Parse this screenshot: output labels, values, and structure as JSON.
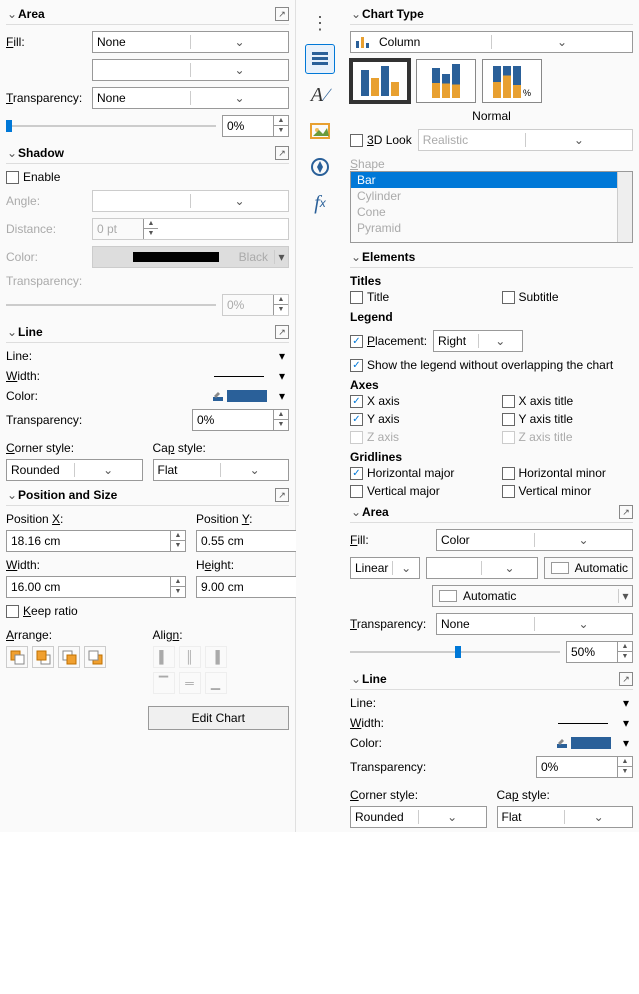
{
  "left": {
    "area": {
      "title": "Area",
      "fill_label": "Fill:",
      "fill_value": "None",
      "secondary": "",
      "trans_label": "Transparency:",
      "trans_value": "None",
      "trans_pct": "0%"
    },
    "shadow": {
      "title": "Shadow",
      "enable": "Enable",
      "angle": "Angle:",
      "distance": "Distance:",
      "distance_val": "0 pt",
      "color": "Color:",
      "color_val": "Black",
      "trans": "Transparency:",
      "trans_val": "0%"
    },
    "line": {
      "title": "Line",
      "line_label": "Line:",
      "width_label": "Width:",
      "color_label": "Color:",
      "trans_label": "Transparency:",
      "trans_val": "0%",
      "corner": "Corner style:",
      "corner_val": "Rounded",
      "cap": "Cap style:",
      "cap_val": "Flat"
    },
    "pos": {
      "title": "Position and Size",
      "px": "Position X:",
      "px_val": "18.16 cm",
      "py": "Position Y:",
      "py_val": "0.55 cm",
      "w": "Width:",
      "w_val": "16.00 cm",
      "h": "Height:",
      "h_val": "9.00 cm",
      "keep": "Keep ratio",
      "arrange": "Arrange:",
      "align": "Align:",
      "edit": "Edit Chart"
    }
  },
  "right": {
    "ct": {
      "title": "Chart Type",
      "type": "Column",
      "subtype_label": "Normal",
      "look3d": "3D Look",
      "look3d_val": "Realistic",
      "shape_label": "Shape",
      "shapes": [
        "Bar",
        "Cylinder",
        "Cone",
        "Pyramid"
      ]
    },
    "el": {
      "title": "Elements",
      "titles": "Titles",
      "title_cb": "Title",
      "subtitle_cb": "Subtitle",
      "legend": "Legend",
      "placement": "Placement:",
      "placement_val": "Right",
      "show_legend": "Show the legend without overlapping the chart",
      "axes": "Axes",
      "xaxis": "X axis",
      "yaxis": "Y axis",
      "zaxis": "Z axis",
      "xtitle": "X axis title",
      "ytitle": "Y axis title",
      "ztitle": "Z axis title",
      "grid": "Gridlines",
      "hm": "Horizontal major",
      "hmn": "Horizontal minor",
      "vm": "Vertical major",
      "vmn": "Vertical minor"
    },
    "area": {
      "title": "Area",
      "fill": "Fill:",
      "fill_val": "Color",
      "linear": "Linear",
      "auto": "Automatic",
      "auto2": "Automatic",
      "trans": "Transparency:",
      "trans_val": "None",
      "trans_pct": "50%"
    },
    "line": {
      "title": "Line",
      "line_label": "Line:",
      "width_label": "Width:",
      "color_label": "Color:",
      "trans_label": "Transparency:",
      "trans_val": "0%",
      "corner": "Corner style:",
      "corner_val": "Rounded",
      "cap": "Cap style:",
      "cap_val": "Flat"
    }
  }
}
